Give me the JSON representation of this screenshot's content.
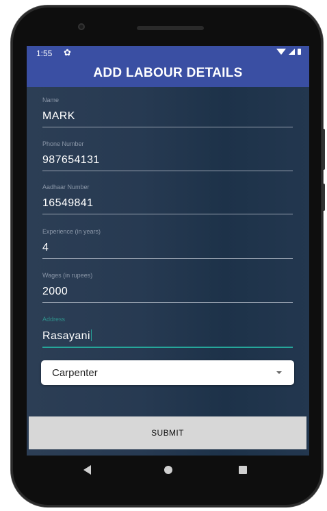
{
  "status_bar": {
    "time": "1:55",
    "settings_icon": "gear-icon",
    "system_icons": [
      "wifi-icon",
      "signal-icon",
      "battery-icon"
    ]
  },
  "app_bar": {
    "title": "ADD LABOUR DETAILS"
  },
  "form": {
    "fields": [
      {
        "label": "Name",
        "value": "MARK"
      },
      {
        "label": "Phone Number",
        "value": "987654131"
      },
      {
        "label": "Aadhaar Number",
        "value": "16549841"
      },
      {
        "label": "Experience (in years)",
        "value": "4"
      },
      {
        "label": "Wages (in rupees)",
        "value": "2000"
      },
      {
        "label": "Address",
        "value": "Rasayani"
      }
    ],
    "focused_field": "Address",
    "labour_type": {
      "selected": "Carpenter"
    },
    "submit_label": "SUBMIT"
  },
  "navigation_bar": {
    "buttons": [
      "back-icon",
      "home-icon",
      "recent-apps-icon"
    ]
  },
  "colors": {
    "accent": "#3a4fa3",
    "focus": "#26a69a",
    "submit_background": "#d7d7d7"
  }
}
